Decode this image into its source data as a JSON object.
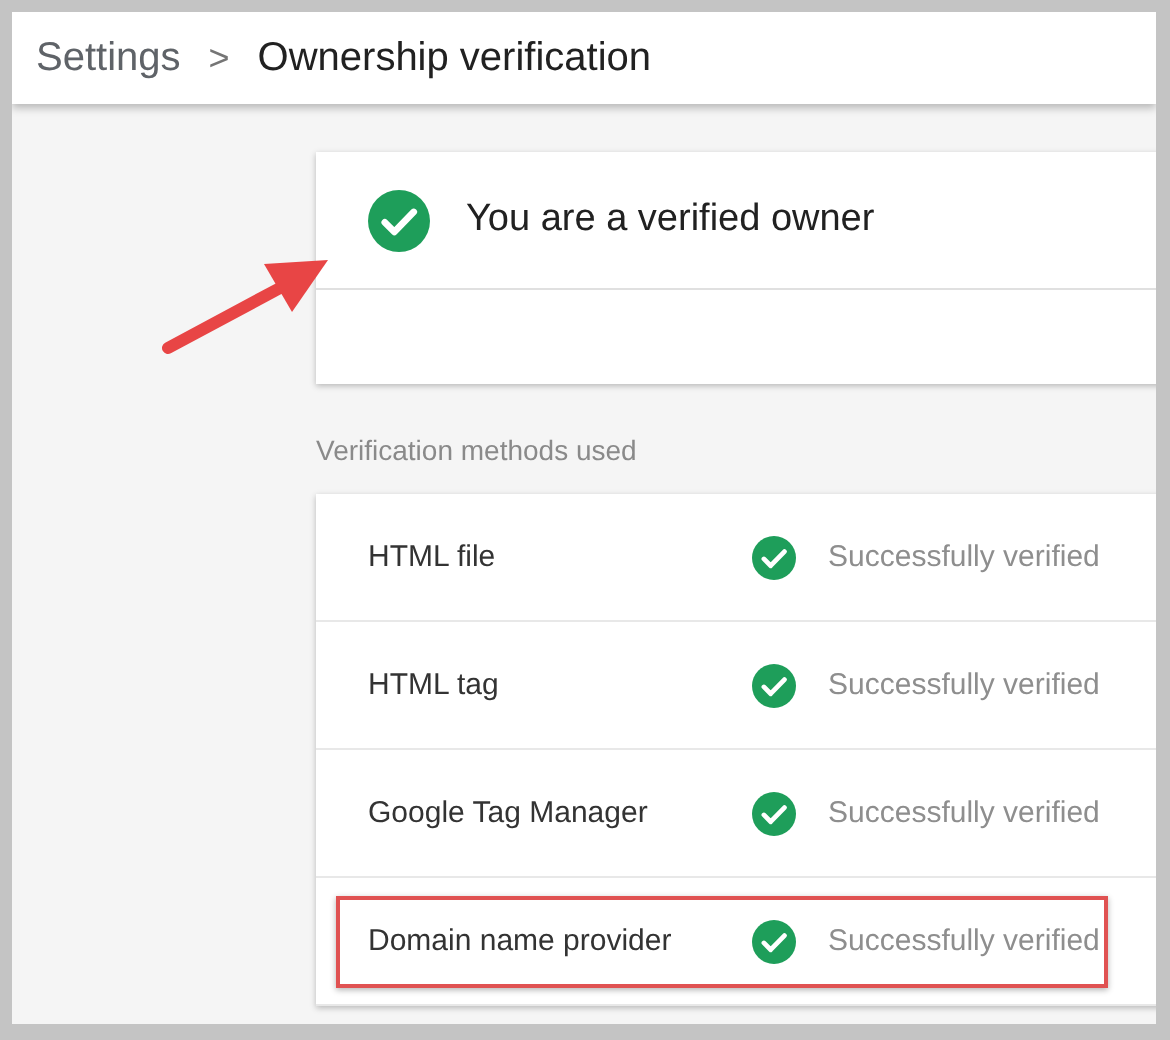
{
  "breadcrumb": {
    "parent": "Settings",
    "separator": ">",
    "current": "Ownership verification"
  },
  "status_card": {
    "title": "You are a verified owner",
    "verified": true
  },
  "methods_label": "Verification methods used",
  "methods": [
    {
      "name": "HTML file",
      "status": "Successfully verified",
      "verified": true,
      "highlighted": false
    },
    {
      "name": "HTML tag",
      "status": "Successfully verified",
      "verified": true,
      "highlighted": false
    },
    {
      "name": "Google Tag Manager",
      "status": "Successfully verified",
      "verified": true,
      "highlighted": false
    },
    {
      "name": "Domain name provider",
      "status": "Successfully verified",
      "verified": true,
      "highlighted": true
    }
  ]
}
